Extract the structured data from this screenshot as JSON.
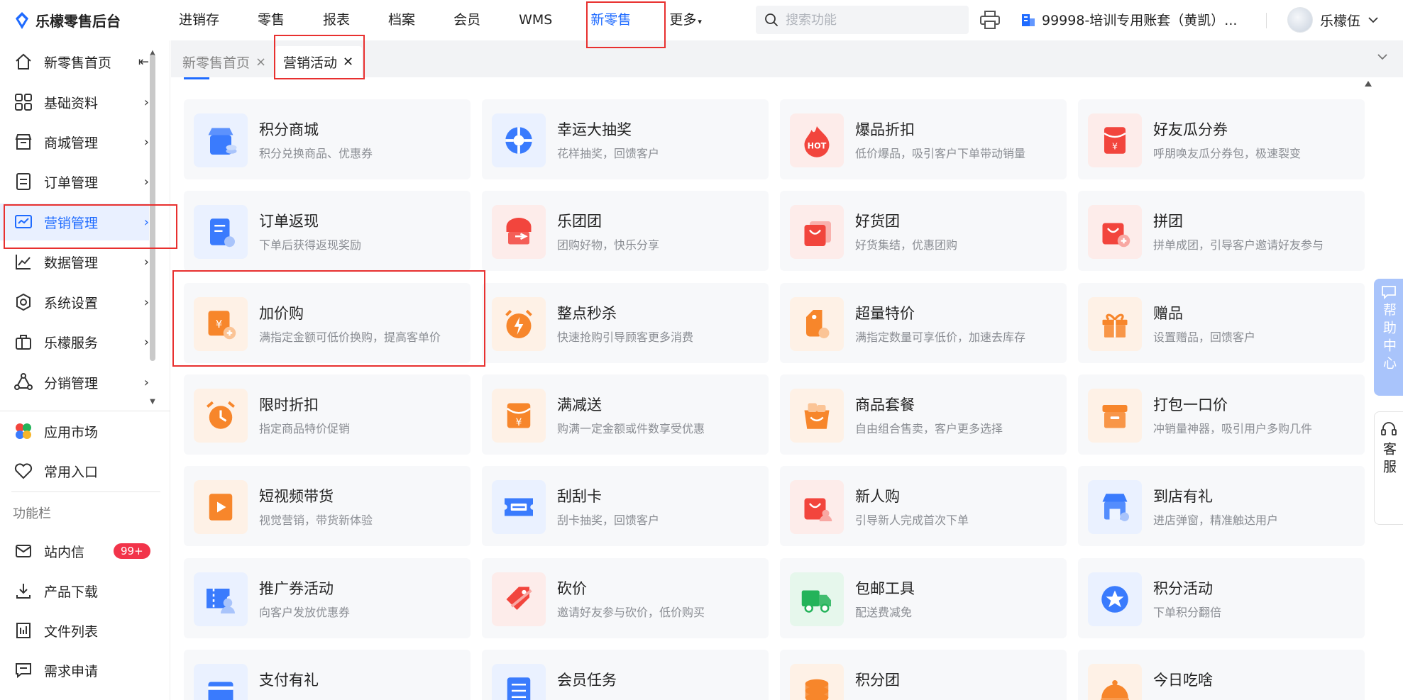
{
  "app": {
    "title": "乐檬零售后台"
  },
  "nav": {
    "items": [
      "进销存",
      "零售",
      "报表",
      "档案",
      "会员",
      "WMS",
      "新零售",
      "更多"
    ],
    "active": "新零售"
  },
  "search": {
    "placeholder": "搜索功能"
  },
  "account": {
    "label": "99998-培训专用账套（黄凯）..."
  },
  "user": {
    "name": "乐檬伍"
  },
  "sidebar": {
    "items": [
      {
        "label": "新零售首页",
        "icon": "home-icon"
      },
      {
        "label": "基础资料",
        "icon": "grid-icon"
      },
      {
        "label": "商城管理",
        "icon": "store-icon"
      },
      {
        "label": "订单管理",
        "icon": "order-icon"
      },
      {
        "label": "营销管理",
        "icon": "marketing-icon"
      },
      {
        "label": "数据管理",
        "icon": "chart-icon"
      },
      {
        "label": "系统设置",
        "icon": "settings-icon"
      },
      {
        "label": "乐檬服务",
        "icon": "service-icon"
      },
      {
        "label": "分销管理",
        "icon": "distribution-icon"
      }
    ],
    "bottom": [
      {
        "label": "应用市场",
        "icon": "app-market-icon"
      },
      {
        "label": "常用入口",
        "icon": "heart-icon"
      }
    ],
    "section_label": "功能栏",
    "tools": [
      {
        "label": "站内信",
        "icon": "mail-icon",
        "badge": "99+"
      },
      {
        "label": "产品下载",
        "icon": "download-icon"
      },
      {
        "label": "文件列表",
        "icon": "file-list-icon"
      },
      {
        "label": "需求申请",
        "icon": "request-icon"
      }
    ]
  },
  "tabs": [
    {
      "label": "新零售首页",
      "close": "×"
    },
    {
      "label": "营销活动",
      "close": "✕"
    }
  ],
  "help": {
    "label": "帮助中心"
  },
  "kefu": {
    "label": "客服"
  },
  "cards": [
    {
      "title": "积分商城",
      "desc": "积分兑换商品、优惠券",
      "icon": "points-mall-icon",
      "color": "#3a7bfd"
    },
    {
      "title": "幸运大抽奖",
      "desc": "花样抽奖，回馈客户",
      "icon": "lucky-wheel-icon",
      "color": "#3a7bfd"
    },
    {
      "title": "爆品折扣",
      "desc": "低价爆品，吸引客户下单带动销量",
      "icon": "hot-icon",
      "color": "#f2453d"
    },
    {
      "title": "好友瓜分券",
      "desc": "呼朋唤友瓜分券包，极速裂变",
      "icon": "red-packet-icon",
      "color": "#f2453d"
    },
    {
      "title": "订单返现",
      "desc": "下单后获得返现奖励",
      "icon": "order-cashback-icon",
      "color": "#3a7bfd"
    },
    {
      "title": "乐团团",
      "desc": "团购好物，快乐分享",
      "icon": "group-buy-icon",
      "color": "#f2453d"
    },
    {
      "title": "好货团",
      "desc": "好货集结，优惠团购",
      "icon": "bag-icon",
      "color": "#f2453d"
    },
    {
      "title": "拼团",
      "desc": "拼单成团，引导客户邀请好友参与",
      "icon": "bag-plus-icon",
      "color": "#f2453d"
    },
    {
      "title": "加价购",
      "desc": "满指定金额可低价换购，提高客单价",
      "icon": "add-price-icon",
      "color": "#f7862b"
    },
    {
      "title": "整点秒杀",
      "desc": "快速抢购引导顾客更多消费",
      "icon": "flash-sale-icon",
      "color": "#f7862b"
    },
    {
      "title": "超量特价",
      "desc": "满指定数量可享低价，加速去库存",
      "icon": "tag-icon",
      "color": "#f7862b"
    },
    {
      "title": "赠品",
      "desc": "设置赠品，回馈客户",
      "icon": "gift-icon",
      "color": "#f7862b"
    },
    {
      "title": "限时折扣",
      "desc": "指定商品特价促销",
      "icon": "alarm-icon",
      "color": "#f7862b"
    },
    {
      "title": "满减送",
      "desc": "购满一定金额或件数享受优惠",
      "icon": "envelope-yen-icon",
      "color": "#f7862b"
    },
    {
      "title": "商品套餐",
      "desc": "自由组合售卖，客户更多选择",
      "icon": "package-bag-icon",
      "color": "#f7862b"
    },
    {
      "title": "打包一口价",
      "desc": "冲销量神器，吸引用户多购几件",
      "icon": "box-icon",
      "color": "#f7862b"
    },
    {
      "title": "短视频带货",
      "desc": "视觉营销，带货新体验",
      "icon": "video-icon",
      "color": "#f7862b"
    },
    {
      "title": "刮刮卡",
      "desc": "刮卡抽奖，回馈客户",
      "icon": "ticket-icon",
      "color": "#3a7bfd"
    },
    {
      "title": "新人购",
      "desc": "引导新人完成首次下单",
      "icon": "new-user-bag-icon",
      "color": "#f2453d"
    },
    {
      "title": "到店有礼",
      "desc": "进店弹窗，精准触达用户",
      "icon": "shop-gift-icon",
      "color": "#3a7bfd"
    },
    {
      "title": "推广券活动",
      "desc": "向客户发放优惠券",
      "icon": "coupon-user-icon",
      "color": "#3a7bfd"
    },
    {
      "title": "砍价",
      "desc": "邀请好友参与砍价，低价购买",
      "icon": "bargain-tag-icon",
      "color": "#f2453d"
    },
    {
      "title": "包邮工具",
      "desc": "配送费减免",
      "icon": "truck-icon",
      "color": "#24b35a"
    },
    {
      "title": "积分活动",
      "desc": "下单积分翻倍",
      "icon": "star-badge-icon",
      "color": "#3a7bfd"
    },
    {
      "title": "支付有礼",
      "desc": "",
      "icon": "payment-gift-icon",
      "color": "#3a7bfd"
    },
    {
      "title": "会员任务",
      "desc": "",
      "icon": "task-list-icon",
      "color": "#3a7bfd"
    },
    {
      "title": "积分团",
      "desc": "",
      "icon": "coin-stack-icon",
      "color": "#f7862b"
    },
    {
      "title": "今日吃啥",
      "desc": "",
      "icon": "dish-icon",
      "color": "#f7862b"
    }
  ]
}
